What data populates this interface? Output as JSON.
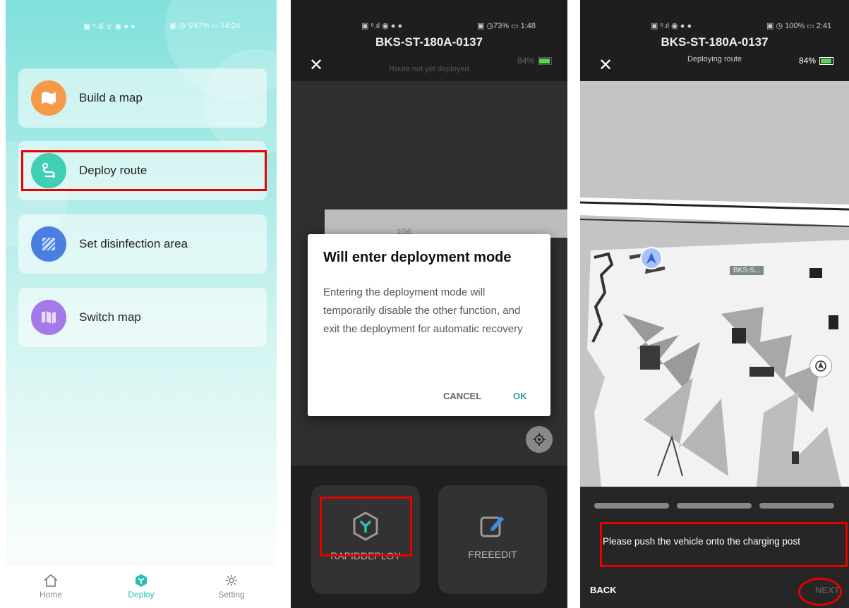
{
  "screen1": {
    "status_left": "▣ ᵉ.ıll ᯤ ◉ ● ●",
    "status_right": "▣ ◷ ⚲47% ▭ 14:24",
    "menu": [
      {
        "label": "Build a map",
        "icon": "map-add-icon",
        "color": "#f59a48"
      },
      {
        "label": "Deploy route",
        "icon": "route-icon",
        "color": "#3fcfb3"
      },
      {
        "label": "Set disinfection area",
        "icon": "area-icon",
        "color": "#4a7ee0"
      },
      {
        "label": "Switch map",
        "icon": "switch-map-icon",
        "color": "#a47ae8"
      }
    ],
    "tabs": [
      {
        "label": "Home",
        "icon": "home-icon"
      },
      {
        "label": "Deploy",
        "icon": "deploy-icon"
      },
      {
        "label": "Setting",
        "icon": "gear-icon"
      }
    ],
    "accent": "#2bbfb3"
  },
  "screen2": {
    "status_right": "▣ ◷73% ▭ 1:48",
    "device": "BKS-ST-180A-0137",
    "subtitle": "Route not yet deployed",
    "battery": "84%",
    "map_label": "1G6",
    "dialog": {
      "title": "Will enter deployment mode",
      "body": "Entering the deployment mode will temporarily disable the other function, and exit the deployment for automatic recovery",
      "cancel": "CANCEL",
      "ok": "OK"
    },
    "rapid": "RAPIDDEPLOY",
    "free": "FREEEDIT",
    "ok_color": "#2a9d8f"
  },
  "screen3": {
    "status_right": "▣ ◷ 100% ▭ 2:41",
    "device": "BKS-ST-180A-0137",
    "subtitle": "Deploying route",
    "battery": "84%",
    "robot_tag": "BKS-S...",
    "progress": [
      1,
      1,
      1
    ],
    "instruction": "Please push the vehicle onto the charging post",
    "back": "BACK",
    "next": "NEXT"
  },
  "highlight_color": "#e60000"
}
